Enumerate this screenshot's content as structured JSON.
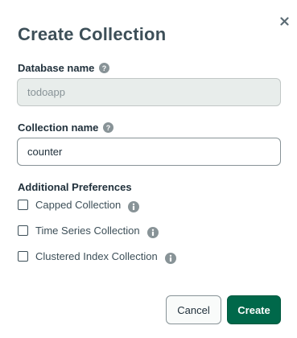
{
  "dialog": {
    "title": "Create Collection",
    "close_icon": "close-icon"
  },
  "database": {
    "label": "Database name",
    "value": "todoapp",
    "disabled": true
  },
  "collection": {
    "label": "Collection name",
    "value": "counter"
  },
  "preferences": {
    "title": "Additional Preferences",
    "options": [
      {
        "label": "Capped Collection",
        "checked": false
      },
      {
        "label": "Time Series Collection",
        "checked": false
      },
      {
        "label": "Clustered Index Collection",
        "checked": false
      }
    ]
  },
  "footer": {
    "cancel_label": "Cancel",
    "create_label": "Create"
  },
  "colors": {
    "primary": "#00684a",
    "title_text": "#3d4f58",
    "disabled_field": "#e8edeb",
    "icon_gray": "#889397"
  }
}
